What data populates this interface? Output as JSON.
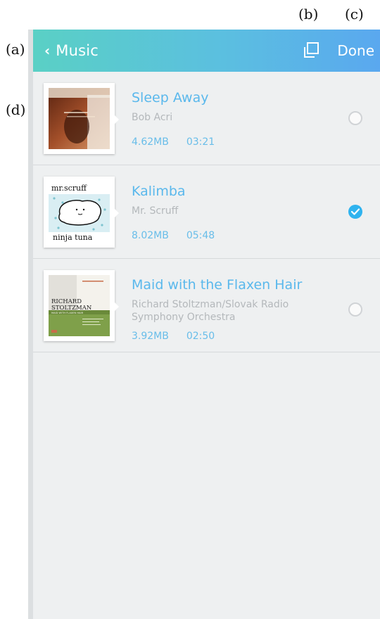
{
  "annotations": {
    "a": "(a)",
    "b": "(b)",
    "c": "(c)",
    "d": "(d)"
  },
  "header": {
    "back_label": "Music",
    "copy_icon": "copy-icon",
    "done_label": "Done",
    "gradient_start": "#5ad0c5",
    "gradient_end": "#5aa8ef"
  },
  "tracks": [
    {
      "title": "Sleep Away",
      "artist": "Bob Acri",
      "size": "4.62MB",
      "duration": "03:21",
      "selected": false,
      "art_icon": "album-art-sleep-away"
    },
    {
      "title": "Kalimba",
      "artist": "Mr. Scruff",
      "size": "8.02MB",
      "duration": "05:48",
      "selected": true,
      "art_icon": "album-art-ninja-tuna",
      "art_text_top": "mr.scruff",
      "art_text_bottom": "ninja tuna"
    },
    {
      "title": "Maid with the Flaxen Hair",
      "artist": "Richard Stoltzman/Slovak Radio Symphony Orchestra",
      "size": "3.92MB",
      "duration": "02:50",
      "selected": false,
      "art_icon": "album-art-richard-stoltzman",
      "art_text_line1": "RICHARD",
      "art_text_line2": "STOLTZMAN",
      "art_text_line3": "MAID WITH FLAXEN HAIR"
    }
  ],
  "colors": {
    "title": "#5ab8ec",
    "artist": "#b4b8bb",
    "meta": "#68bde9",
    "check": "#2fb3ef",
    "background": "#eef0f1"
  }
}
